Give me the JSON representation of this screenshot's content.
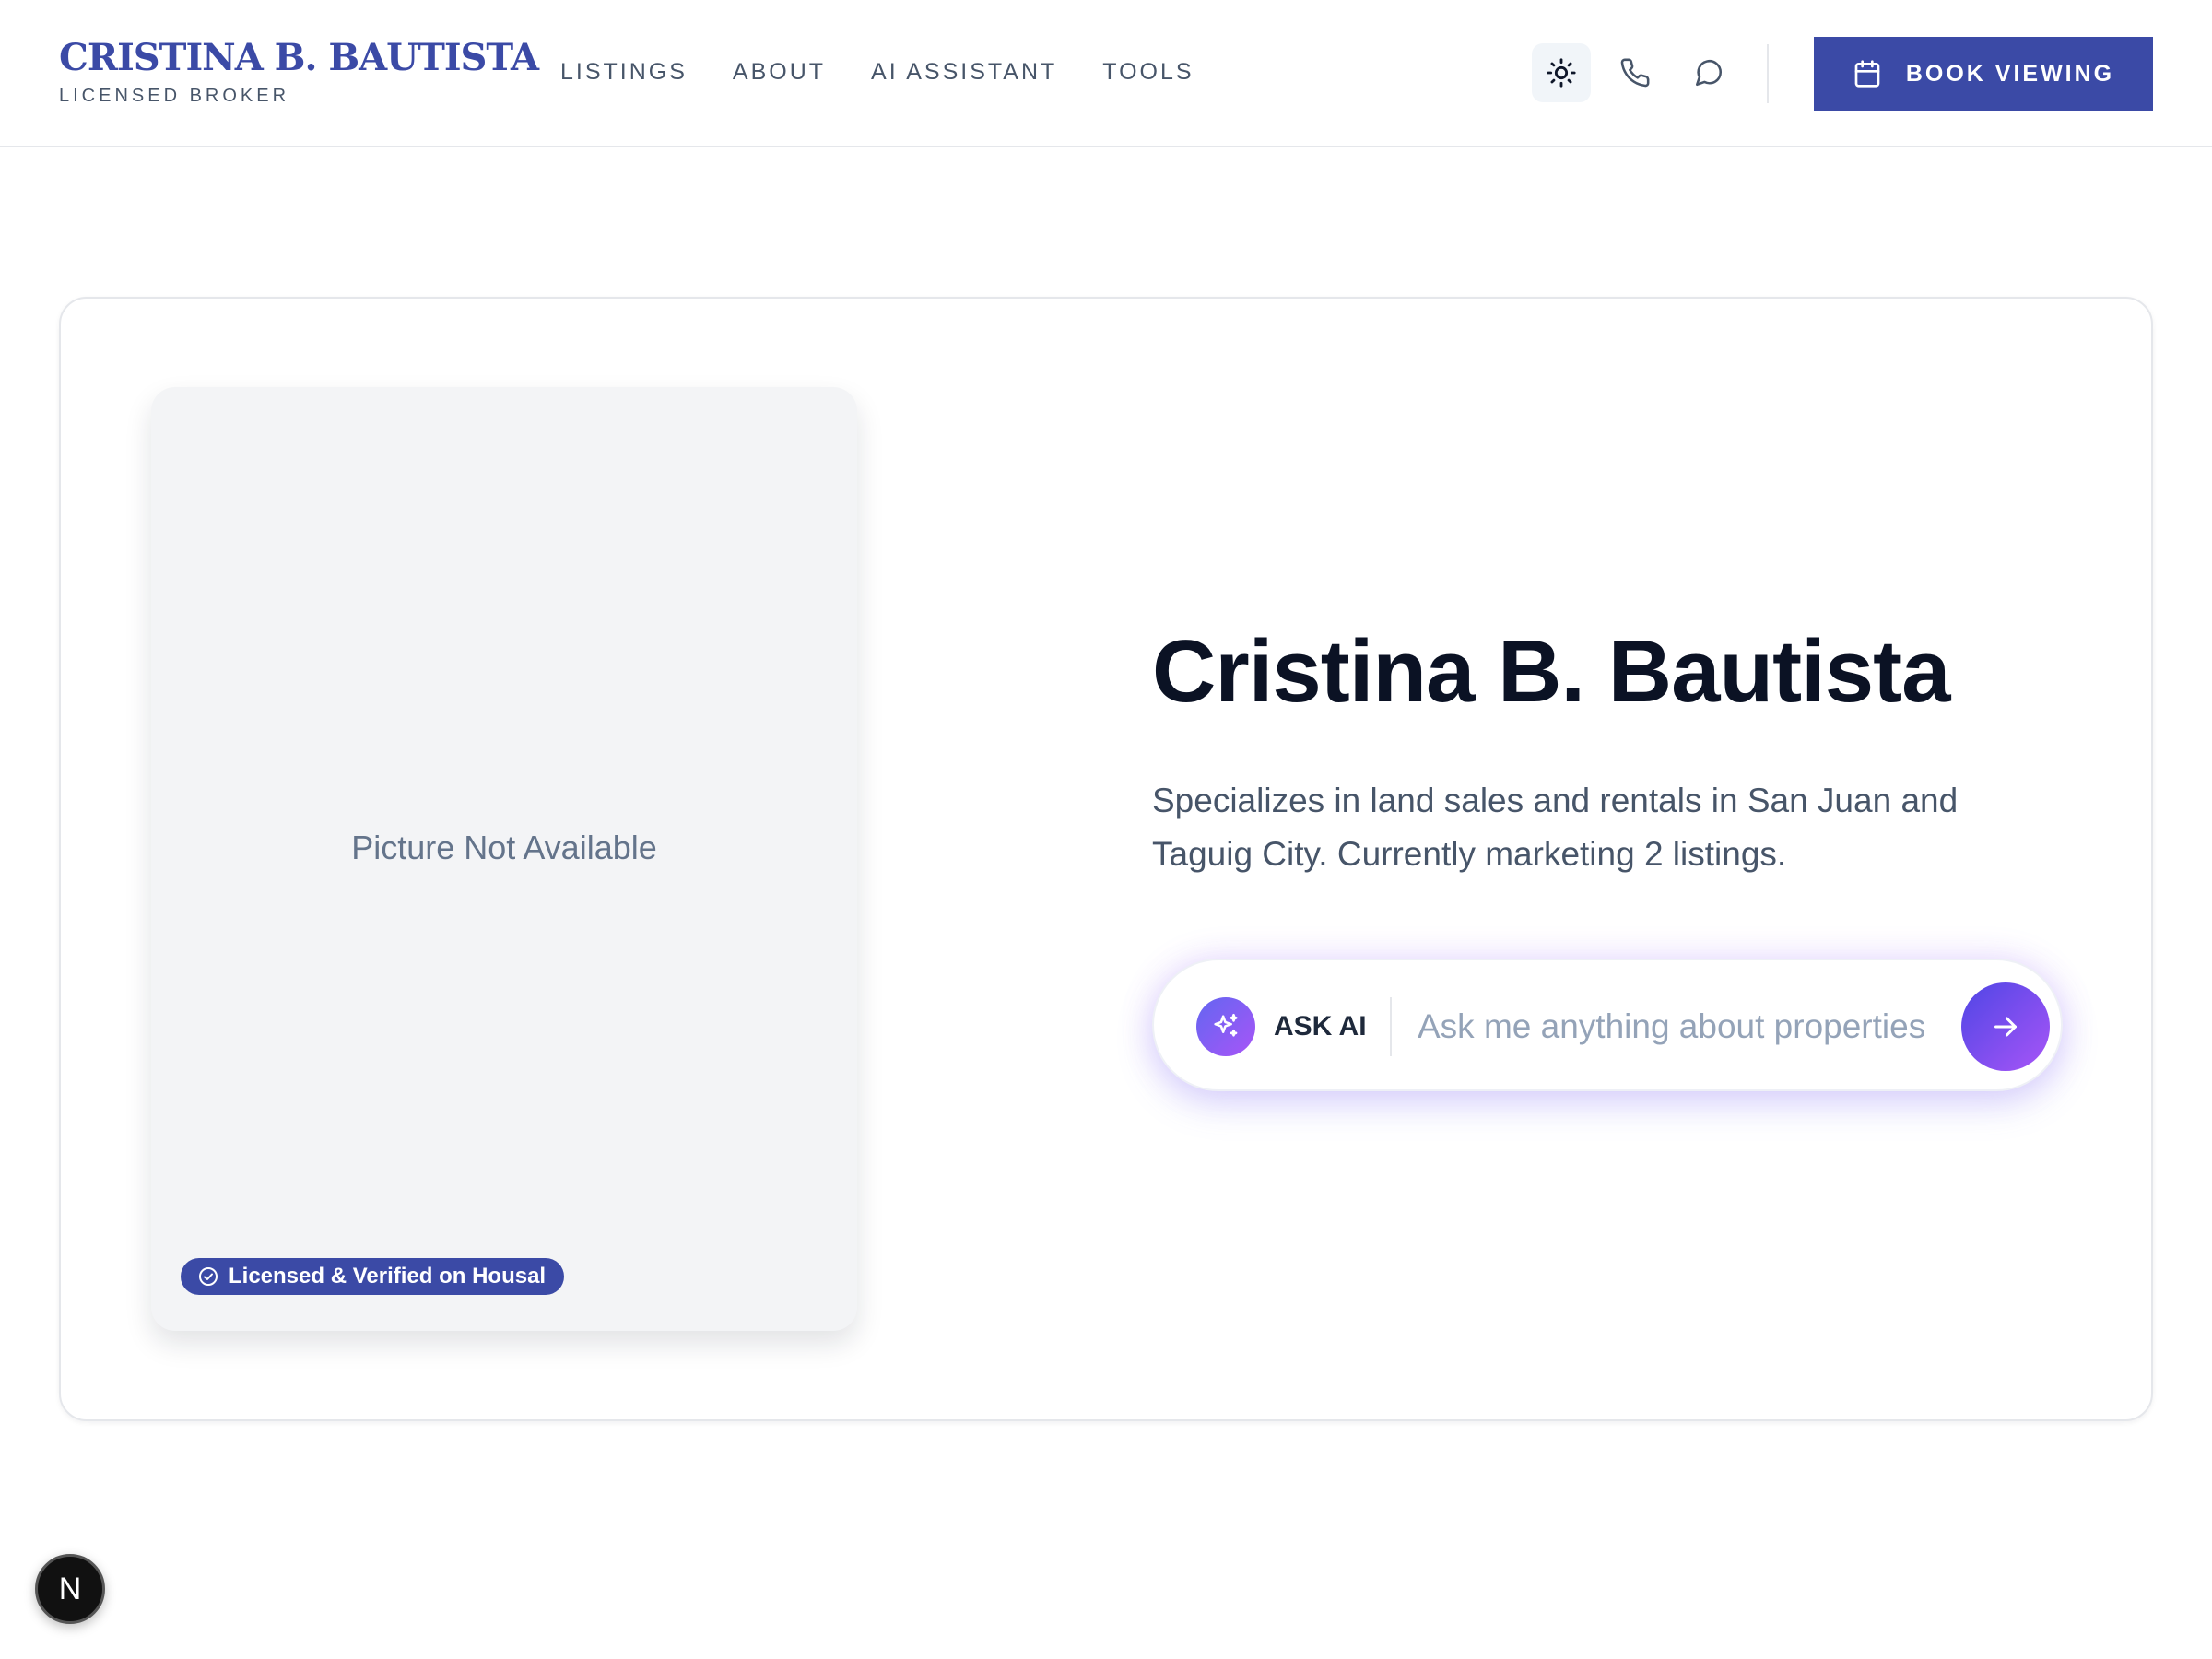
{
  "header": {
    "brand_name": "CRISTINA B. BAUTISTA",
    "brand_subtitle": "LICENSED BROKER",
    "nav": [
      "LISTINGS",
      "ABOUT",
      "AI ASSISTANT",
      "TOOLS"
    ],
    "icons": [
      "sun-icon",
      "phone-icon",
      "chat-icon"
    ],
    "book_button_label": "BOOK VIEWING"
  },
  "profile": {
    "photo_placeholder": "Picture Not Available",
    "verified_badge": "Licensed & Verified on Housal",
    "name": "Cristina B. Bautista",
    "description": "Specializes in land sales and rentals in San Juan and Taguig City. Currently marketing 2 listings."
  },
  "ask_ai": {
    "label": "ASK AI",
    "placeholder": "Ask me anything about properties"
  },
  "floating_badge": "N",
  "colors": {
    "brand": "#3b4aa6",
    "accent_gradient_start": "#6366f1",
    "accent_gradient_end": "#a855f7",
    "text_dark": "#0b1224",
    "text_muted": "#475569"
  }
}
